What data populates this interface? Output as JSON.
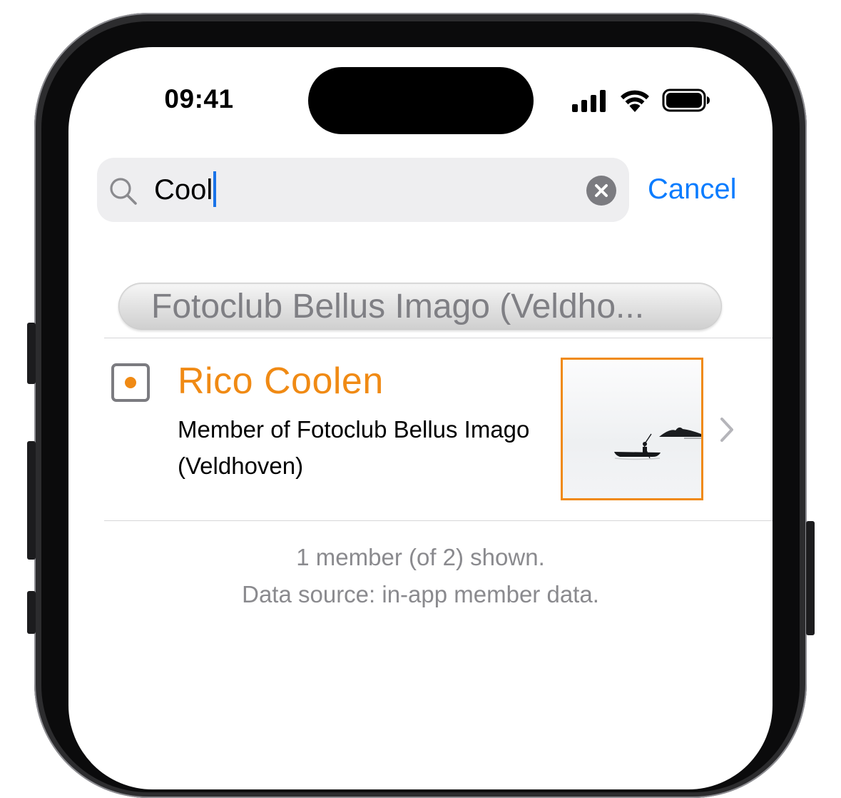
{
  "status_bar": {
    "time": "09:41",
    "icons": [
      "cellular-signal-icon",
      "wifi-icon",
      "battery-icon"
    ]
  },
  "search": {
    "value": "Cool",
    "clear_icon": "clear-x-icon",
    "cancel_label": "Cancel"
  },
  "section": {
    "title": "Fotoclub Bellus Imago (Veldho..."
  },
  "members": [
    {
      "name": "Rico Coolen",
      "description": "Member of Fotoclub Bellus Imago (Veldhoven)",
      "thumbnail": "photo-thumbnail",
      "selected_state": "partial"
    }
  ],
  "footer": {
    "count_text": "1 member (of 2) shown.",
    "source_text": "Data source: in-app member data."
  },
  "colors": {
    "accent_orange": "#f08a14",
    "link_blue": "#0a7cff",
    "secondary_text": "#8a8a8e"
  }
}
